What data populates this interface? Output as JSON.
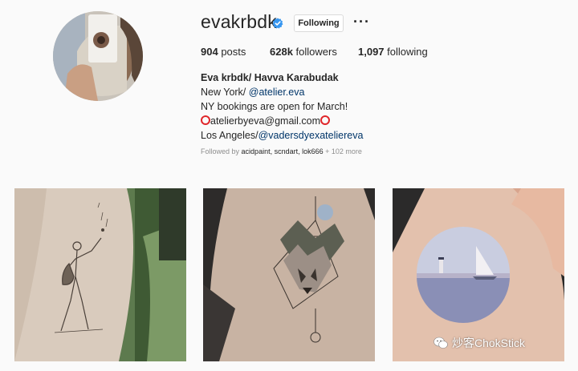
{
  "profile": {
    "username": "evakrbdk",
    "follow_label": "Following",
    "more_label": "···",
    "stats": {
      "posts_count": "904",
      "posts_label": "posts",
      "followers_count": "628k",
      "followers_label": "followers",
      "following_count": "1,097",
      "following_label": "following"
    },
    "bio": {
      "name": "Eva krbdk/ Havva Karabudak",
      "line1_prefix": "New York/ ",
      "line1_link": "@atelier.eva",
      "line2": "NY bookings are open for March!",
      "line3": "atelierbyeva@gmail.com",
      "line4_prefix": "Los Angeles/",
      "line4_link": "@vadersdyexateliereva"
    },
    "followed_by": {
      "prefix": "Followed by",
      "names": "acidpaint, scndart, lok666",
      "suffix": "+ 102 more"
    }
  },
  "posts": [
    {
      "subject": "skeleton-tattoo"
    },
    {
      "subject": "fox-tattoo"
    },
    {
      "subject": "lighthouse-tattoo"
    }
  ],
  "watermark": {
    "text": "炒客ChokStick"
  },
  "colors": {
    "verified": "#3897f0",
    "link": "#003569",
    "ring": "#e0262a"
  }
}
